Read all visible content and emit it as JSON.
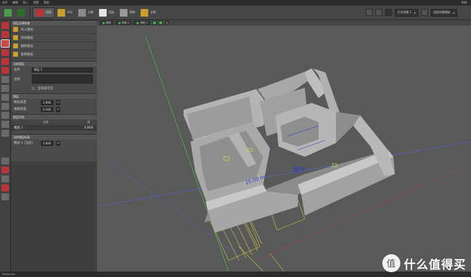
{
  "menubar": {
    "items": [
      "文件",
      "编辑",
      "插入",
      "视图",
      "帮助"
    ],
    "right_label": "帮助"
  },
  "toolbar": {
    "buttons": [
      "绘图",
      "灯光",
      "计算",
      "渲染",
      "视频",
      "全景"
    ],
    "right_dropdown": "打光场景 1",
    "right_dropdown2": "渲染场景模板"
  },
  "panel": {
    "header": "楼层及建筑物",
    "actions": [
      "导入楼层",
      "添加楼层",
      "删除楼层",
      "复制楼层"
    ],
    "current_floor_title": "当前楼层",
    "name_label": "名称",
    "name_value": "楼层 1",
    "desc_label": "说明",
    "checkbox_label": "当前层可见",
    "floor_title": "楼层",
    "height_label": "楼层高度",
    "height_value": "2.800",
    "thick_label": "楼板厚度",
    "thick_value": "0.200",
    "unit": "m",
    "list_title": "楼层列表",
    "col_name": "名称",
    "col_height": "高",
    "row_name": "楼层 1",
    "row_height": "2.800",
    "elevation_title": "当前楼层标高",
    "elevation_label": "楼层 1 (当前)",
    "elevation_value": "2.800"
  },
  "viewport": {
    "tabs": [
      "透视",
      "视角 1",
      "视角 2"
    ],
    "label_room": "客厅",
    "label_dims": "25.00 m²"
  },
  "status": {
    "text": "Dialux evo"
  },
  "watermark": {
    "text": "什么值得买",
    "glyph": "值"
  },
  "colors": {
    "accent_red": "#b8353b",
    "wall": "#b4b4b4",
    "plan_lines": "#d4d040",
    "dim_blue": "#2d3ad6"
  }
}
